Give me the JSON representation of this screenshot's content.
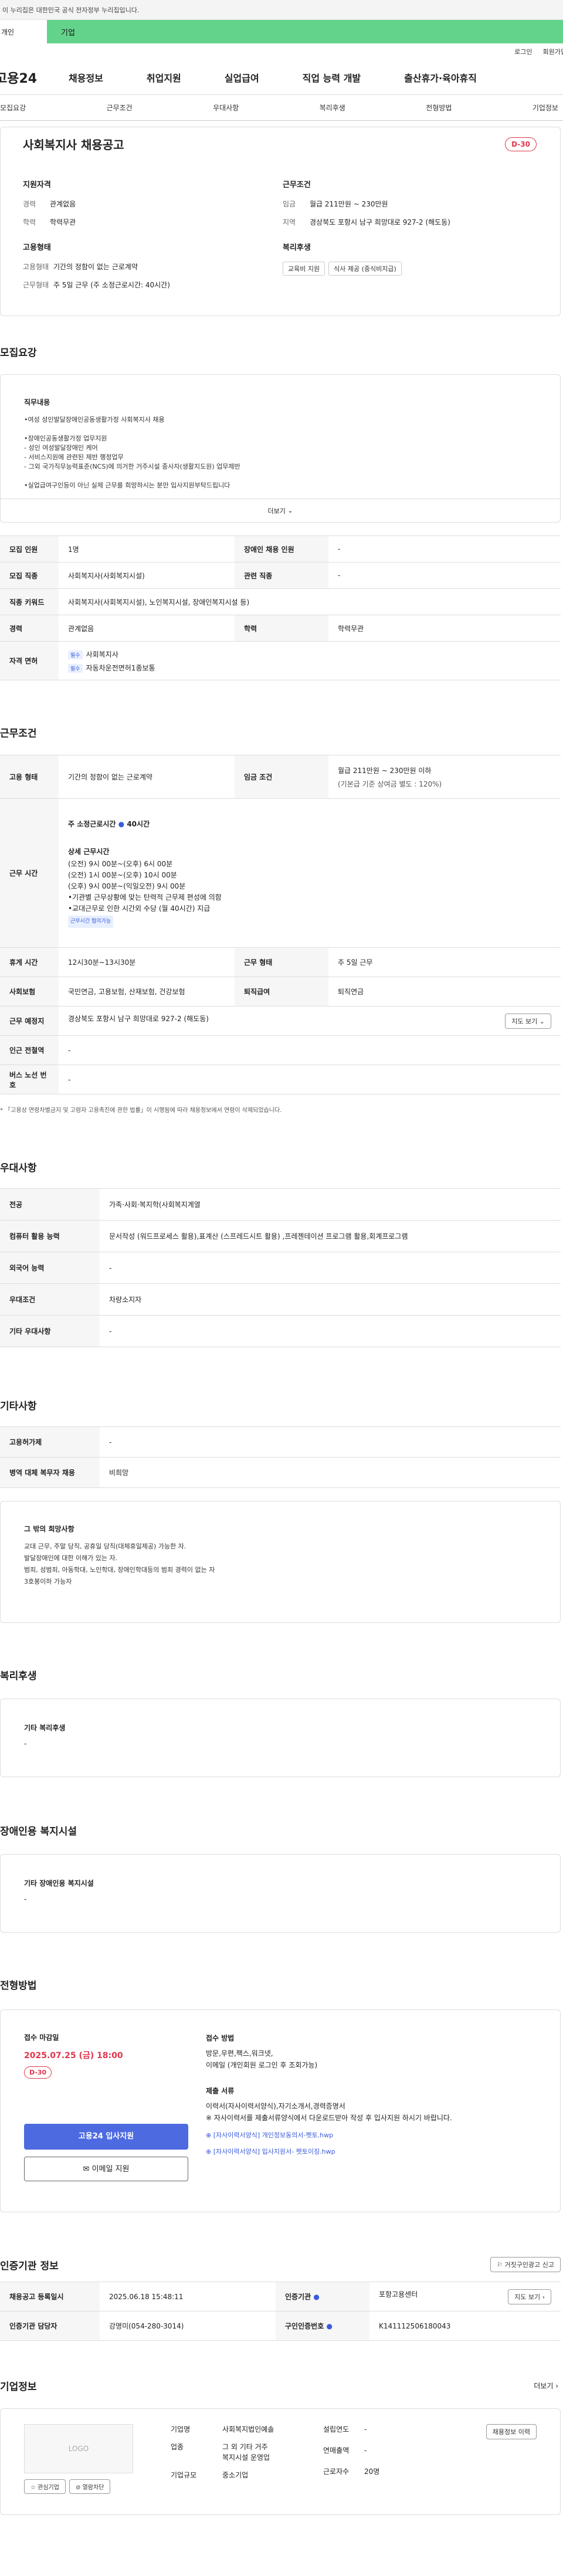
{
  "gov_banner": "이 누리집은 대한민국 공식 전자정부 누리집입니다.",
  "tabs": [
    "개인",
    "기업"
  ],
  "util": [
    "로그인",
    "회원가입"
  ],
  "logo": "고용24",
  "gnb": [
    "채용정보",
    "취업지원",
    "실업급여",
    "직업 능력 개발",
    "출산휴가·육아휴직"
  ],
  "anchors": [
    "모집요강",
    "근무조건",
    "우대사항",
    "복리후생",
    "전형방법",
    "기업정보"
  ],
  "job": {
    "title": "사회복지사 채용공고",
    "dday": "D-30",
    "req_h": "지원자격",
    "career_k": "경력",
    "career_v": "관계없음",
    "edu_k": "학력",
    "edu_v": "학력무관",
    "emp_h": "고용형태",
    "emptype_k": "고용형태",
    "emptype_v": "기간의 정함이 없는 근로계약",
    "hours_k": "근무형태",
    "hours_v": "주 5일 근무 (주 소정근로시간: 40시간)",
    "cond_h": "근무조건",
    "wage_k": "임금",
    "wage_v": "월급 211만원 ~ 230만원",
    "loc_k": "지역",
    "loc_v": "경상북도 포항시 남구 희망대로 927-2 (해도동)",
    "welf_h": "복리후생",
    "welf_chips": [
      "교육비 지원",
      "식사 제공 (중식비지급)"
    ]
  },
  "s1": {
    "title": "모집요강",
    "duty_h": "직무내용",
    "duty_lines": [
      "•여성 성인발달장애인공동생활가정 사회복지사 채용",
      "",
      "•장애인공동생활가정 업무지원",
      "- 성인 여성발달장애인 케어",
      "- 서비스지원에 관련된 제반 행정업무",
      "- 그외 국가직무능력표준(NCS)에 의거한 거주시설 종사자(생활지도원) 업무제반",
      "",
      "•실업급여구인등이 아닌 실제 근무를 희망하시는 분만 입사지원부탁드립니다"
    ],
    "more": "더보기",
    "rows": [
      {
        "k": "모집 인원",
        "v": "1명",
        "k2": "장애인 채용 인원",
        "v2": "-"
      },
      {
        "k": "모집 직종",
        "v": "사회복지사(사회복지시설)",
        "k2": "관련 직종",
        "v2": "-"
      },
      {
        "k": "직종 키워드",
        "v": "사회복지사(사회복지시설), 노인복지시설, 장애인복지시설 등)"
      },
      {
        "k": "경력",
        "v": "관계없음",
        "k2": "학력",
        "v2": "학력무관"
      }
    ],
    "lic_k": "자격 면허",
    "lic_tag": "필수",
    "lic": [
      "사회복지사",
      "자동차운전면허1종보통"
    ]
  },
  "s2": {
    "title": "근무조건",
    "emp_k": "고용 형태",
    "emp_v": "기간의 정함이 없는 근로계약",
    "wage_k": "임금 조건",
    "wage_v": "월급 211만원 ~ 230만원 이하",
    "wage_note": "(기본급 기준 상여금 별도 : 120%)",
    "time_k": "근무 시간",
    "time_head": "주 소정근로시간",
    "time_hours": "40시간",
    "detail_h": "상세 근무시간",
    "detail": [
      "(오전) 9시 00분~(오후) 6시 00분",
      "(오전) 1시 00분~(오후) 10시 00분",
      "(오후) 9시 00분~(익일오전) 9시 00분",
      "•기관별 근무상황에 맞는 탄력적 근무제 편성에 의함",
      "•교대근무로 인한 시간외 수당 (월 40시간) 지급"
    ],
    "flex": "근무시간 협의가능",
    "break_k": "휴게 시간",
    "break_v": "12시30분~13시30분",
    "form_k": "근무 형태",
    "form_v": "주 5일 근무",
    "ins_k": "사회보험",
    "ins_v": "국민연금, 고용보험, 산재보험, 건강보험",
    "ret_k": "퇴직급여",
    "ret_v": "퇴직연금",
    "place_k": "근무 예정지",
    "place_v": "경상북도 포항시 남구 희망대로 927-2 (해도동)",
    "map": "지도 보기",
    "sub_k": "인근 전철역",
    "sub_v": "-",
    "bus_k": "버스 노선 번호",
    "bus_v": "-",
    "note": "* 「고용상 연령차별금지 및 고령자 고용촉진에 관한 법률」이 시행됨에 따라 채용정보에서 연령이 삭제되었습니다."
  },
  "s3": {
    "title": "우대사항",
    "rows": [
      {
        "k": "전공",
        "v": "가족·사회·복지학(사회복지계열"
      },
      {
        "k": "컴퓨터 활용 능력",
        "v": "문서작성 (워드프로세스 활용),표계산 (스프레드시트 활용) ,프레젠테이션 프로그램 활용,회계프로그램"
      },
      {
        "k": "외국어 능력",
        "v": "-"
      },
      {
        "k": "우대조건",
        "v": "차량소지자"
      },
      {
        "k": "기타 우대사항",
        "v": "-"
      }
    ]
  },
  "s4": {
    "title": "기타사항",
    "rows": [
      {
        "k": "고용허가제",
        "v": "-"
      },
      {
        "k": "병역 대체 복무자 채용",
        "v": "비희망"
      }
    ],
    "wish_h": "그 밖의 희망사항",
    "wish": [
      "교대 근무, 주말 당직, 공휴일 당직(대체휴일제공) 가능한 자.",
      "발달장애인에 대한 이해가 있는 자.",
      "범죄, 성범죄, 아동학대, 노인학대, 장애인학대등의 범죄 경력이 없는 자",
      "3호봉이하 가능자"
    ]
  },
  "s5": {
    "title": "복리후생",
    "h": "기타 복리후생",
    "v": "-"
  },
  "s6": {
    "title": "장애인용 복지시설",
    "h": "기타 장애인용 복지시설",
    "v": "-"
  },
  "s7": {
    "title": "전형방법",
    "deadline_h": "접수 마감일",
    "deadline": "2025.07.25 (금) 18:00",
    "dday": "D-30",
    "apply": "고용24 입사지원",
    "mail": "이메일 지원",
    "method_h": "접수 방법",
    "method": [
      "방문,우편,팩스,워크넷,",
      "이메일 (개인회원 로그인 후 조회가능)"
    ],
    "docs_h": "제출 서류",
    "docs": [
      "이력서(자사이력서양식),자기소개서,경력증명서",
      "※ 자사이력서를 제출서류양식에서 다운로드받아 작성 후 입사지원 하시기 바랍니다."
    ],
    "files": [
      "[자사이력서양식] 개인정보동의서-펫토.hwp",
      "[자사이력서양식] 입사지원서- 펫토이징.hwp"
    ]
  },
  "s8": {
    "title": "인증기관 정보",
    "report": "거짓구인광고 신고",
    "reg_k": "채용공고 등록일시",
    "reg_v": "2025.06.18 15:48:11",
    "org_k": "인증기관",
    "org_v": "포항고용센터",
    "map": "지도 보기",
    "mgr_k": "인증기관 담당자",
    "mgr_v": "강명미(054-280-3014)",
    "no_k": "구인인증번호",
    "no_v": "K141112506180043"
  },
  "s9": {
    "title": "기업정보",
    "more": "더보기",
    "logo": "LOGO",
    "fav": "관심기업",
    "block": "열람차단",
    "hire": "채용정보 이력",
    "k1": "기업명",
    "v1": "사회복지법인예솔",
    "k2": "업종",
    "v2": [
      "그 외 기타 거주",
      "복지시설 운영업"
    ],
    "k3": "기업규모",
    "v3": "중소기업",
    "k4": "설립연도",
    "v4": "-",
    "k5": "연매출액",
    "v5": "-",
    "k6": "근로자수",
    "v6": "20명"
  }
}
